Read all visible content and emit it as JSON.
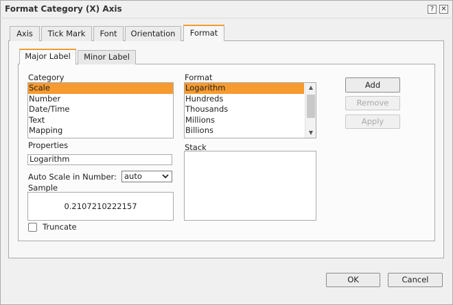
{
  "window": {
    "title": "Format Category (X) Axis",
    "help_glyph": "?",
    "close_glyph": "✕"
  },
  "tabs": [
    {
      "label": "Axis"
    },
    {
      "label": "Tick Mark"
    },
    {
      "label": "Font"
    },
    {
      "label": "Orientation"
    },
    {
      "label": "Format"
    }
  ],
  "active_tab": "Format",
  "subtabs": [
    {
      "label": "Major Label"
    },
    {
      "label": "Minor Label"
    }
  ],
  "active_subtab": "Major Label",
  "category": {
    "label": "Category",
    "items": [
      "Scale",
      "Number",
      "Date/Time",
      "Text",
      "Mapping"
    ],
    "selected": "Scale"
  },
  "format": {
    "label": "Format",
    "items": [
      "Logarithm",
      "Hundreds",
      "Thousands",
      "Millions",
      "Billions"
    ],
    "selected": "Logarithm"
  },
  "properties": {
    "label": "Properties",
    "value": "Logarithm"
  },
  "auto_scale": {
    "label": "Auto Scale in Number:",
    "value": "auto"
  },
  "sample": {
    "label": "Sample",
    "value": "0.2107210222157"
  },
  "stack": {
    "label": "Stack"
  },
  "truncate": {
    "label": "Truncate",
    "checked": false
  },
  "actions": {
    "add": "Add",
    "remove": "Remove",
    "apply": "Apply"
  },
  "footer": {
    "ok": "OK",
    "cancel": "Cancel"
  },
  "colors": {
    "accent": "#f39a2b",
    "selection": "#f79a2f"
  }
}
